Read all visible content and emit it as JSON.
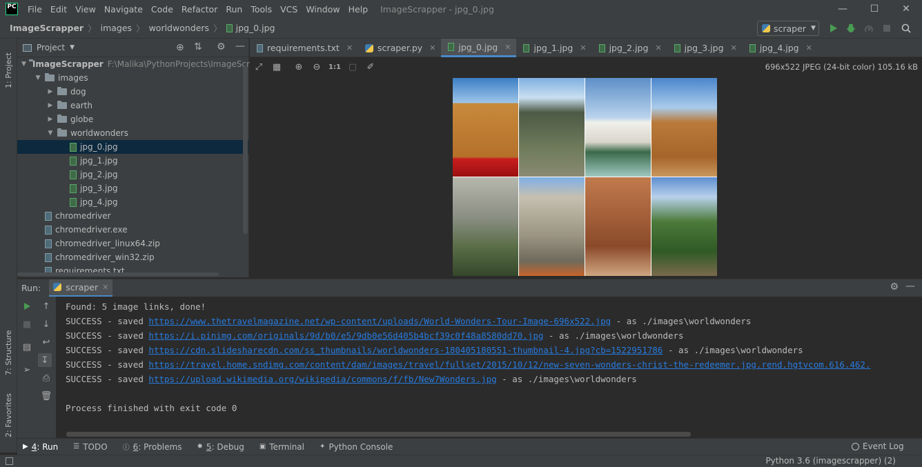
{
  "app": {
    "logo": "PC",
    "window_title": "ImageScrapper - jpg_0.jpg"
  },
  "menu": [
    "File",
    "Edit",
    "View",
    "Navigate",
    "Code",
    "Refactor",
    "Run",
    "Tools",
    "VCS",
    "Window",
    "Help"
  ],
  "breadcrumbs": [
    "ImageScrapper",
    "images",
    "worldwonders",
    "jpg_0.jpg"
  ],
  "toolbar": {
    "run_config": "scraper"
  },
  "left_strip": {
    "project": "1: Project",
    "structure": "7: Structure",
    "favorites": "2: Favorites"
  },
  "project_panel": {
    "title": "Project",
    "tree": [
      {
        "label": "ImageScrapper",
        "path": "F:\\Malika\\PythonProjects\\ImageScrap",
        "kind": "folder",
        "level": 0,
        "expanded": true
      },
      {
        "label": "images",
        "kind": "folder",
        "level": 1,
        "expanded": true
      },
      {
        "label": "dog",
        "kind": "folder",
        "level": 2,
        "expanded": false
      },
      {
        "label": "earth",
        "kind": "folder",
        "level": 2,
        "expanded": false
      },
      {
        "label": "globe",
        "kind": "folder",
        "level": 2,
        "expanded": false
      },
      {
        "label": "worldwonders",
        "kind": "folder",
        "level": 2,
        "expanded": true
      },
      {
        "label": "jpg_0.jpg",
        "kind": "image",
        "level": 3,
        "selected": true
      },
      {
        "label": "jpg_1.jpg",
        "kind": "image",
        "level": 3
      },
      {
        "label": "jpg_2.jpg",
        "kind": "image",
        "level": 3
      },
      {
        "label": "jpg_3.jpg",
        "kind": "image",
        "level": 3
      },
      {
        "label": "jpg_4.jpg",
        "kind": "image",
        "level": 3
      },
      {
        "label": "chromedriver",
        "kind": "file",
        "level": 1
      },
      {
        "label": "chromedriver.exe",
        "kind": "file",
        "level": 1
      },
      {
        "label": "chromedriver_linux64.zip",
        "kind": "file",
        "level": 1
      },
      {
        "label": "chromedriver_win32.zip",
        "kind": "file",
        "level": 1
      },
      {
        "label": "requirements.txt",
        "kind": "file",
        "level": 1
      }
    ]
  },
  "editor_tabs": [
    {
      "label": "requirements.txt",
      "active": false
    },
    {
      "label": "scraper.py",
      "active": false
    },
    {
      "label": "jpg_0.jpg",
      "active": true
    },
    {
      "label": "jpg_1.jpg",
      "active": false
    },
    {
      "label": "jpg_2.jpg",
      "active": false
    },
    {
      "label": "jpg_3.jpg",
      "active": false
    },
    {
      "label": "jpg_4.jpg",
      "active": false
    }
  ],
  "image_viewer": {
    "info": "696x522 JPEG (24-bit color) 105.16 kB",
    "zoom_actual": "1:1"
  },
  "run_panel": {
    "label": "Run:",
    "tab": "scraper",
    "lines": [
      {
        "prefix": "Found: 5 image links, done!"
      },
      {
        "prefix": "SUCCESS - saved ",
        "link": "https://www.thetravelmagazine.net/wp-content/uploads/World-Wonders-Tour-Image-696x522.jpg",
        "suffix": " - as ./images\\worldwonders"
      },
      {
        "prefix": "SUCCESS - saved ",
        "link": "https://i.pinimg.com/originals/9d/b0/e5/9db0e56d405b4bcf39c0f48a8580dd70.jpg",
        "suffix": " - as ./images\\worldwonders"
      },
      {
        "prefix": "SUCCESS - saved ",
        "link": "https://cdn.slidesharecdn.com/ss_thumbnails/worldwonders-180405180551-thumbnail-4.jpg?cb=1522951786",
        "suffix": " - as ./images\\worldwonders"
      },
      {
        "prefix": "SUCCESS - saved ",
        "link": "https://travel.home.sndimg.com/content/dam/images/travel/fullset/2015/10/12/new-seven-wonders-christ-the-redeemer.jpg.rend.hgtvcom.616.462.",
        "suffix": ""
      },
      {
        "prefix": "SUCCESS - saved ",
        "link": "https://upload.wikimedia.org/wikipedia/commons/f/fb/New7Wonders.jpg",
        "suffix": " - as ./images\\worldwonders"
      },
      {
        "prefix": ""
      },
      {
        "prefix": "Process finished with exit code 0"
      }
    ]
  },
  "bottom_tabs": [
    {
      "key": "4",
      "label": ": Run",
      "active": true
    },
    {
      "key": "",
      "label": "TODO",
      "active": false
    },
    {
      "key": "6",
      "label": ": Problems",
      "active": false
    },
    {
      "key": "5",
      "label": ": Debug",
      "active": false
    },
    {
      "key": "",
      "label": "Terminal",
      "active": false
    },
    {
      "key": "",
      "label": "Python Console",
      "active": false
    }
  ],
  "event_log": "Event Log",
  "status": {
    "interpreter": "Python 3.6 (imagescrapper) (2)"
  },
  "colors": {
    "accent": "#4a88c7",
    "link": "#287bde",
    "selection": "#0d293e",
    "run_green": "#499c54"
  }
}
